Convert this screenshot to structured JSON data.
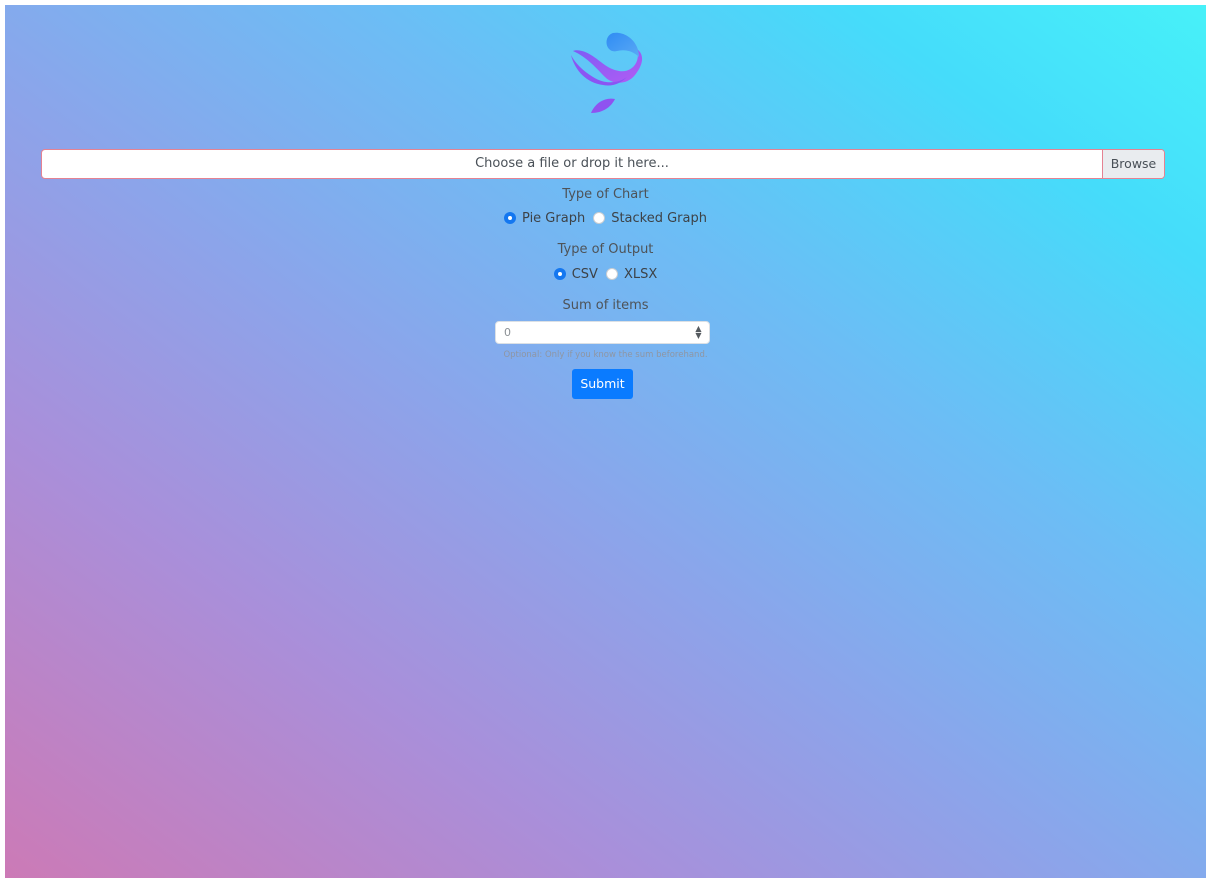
{
  "upload": {
    "placeholder": "Choose a file or drop it here...",
    "browse_label": "Browse"
  },
  "chart_type": {
    "label": "Type of Chart",
    "options": [
      {
        "label": "Pie Graph",
        "selected": true
      },
      {
        "label": "Stacked Graph",
        "selected": false
      }
    ]
  },
  "output_type": {
    "label": "Type of Output",
    "options": [
      {
        "label": "CSV",
        "selected": true
      },
      {
        "label": "XLSX",
        "selected": false
      }
    ]
  },
  "sum": {
    "label": "Sum of items",
    "value": "0",
    "help": "Optional: Only if you know the sum beforehand."
  },
  "submit_label": "Submit",
  "colors": {
    "primary": "#0a7bff",
    "radio_selected": "#1477f0",
    "invalid_border": "#e58292",
    "gradient_bottom_left": "#cc7ab6",
    "gradient_top_right": "#47f1f9"
  },
  "icons": {
    "logo": "brand-logo-icon",
    "spinner": "number-spinner-icon"
  }
}
